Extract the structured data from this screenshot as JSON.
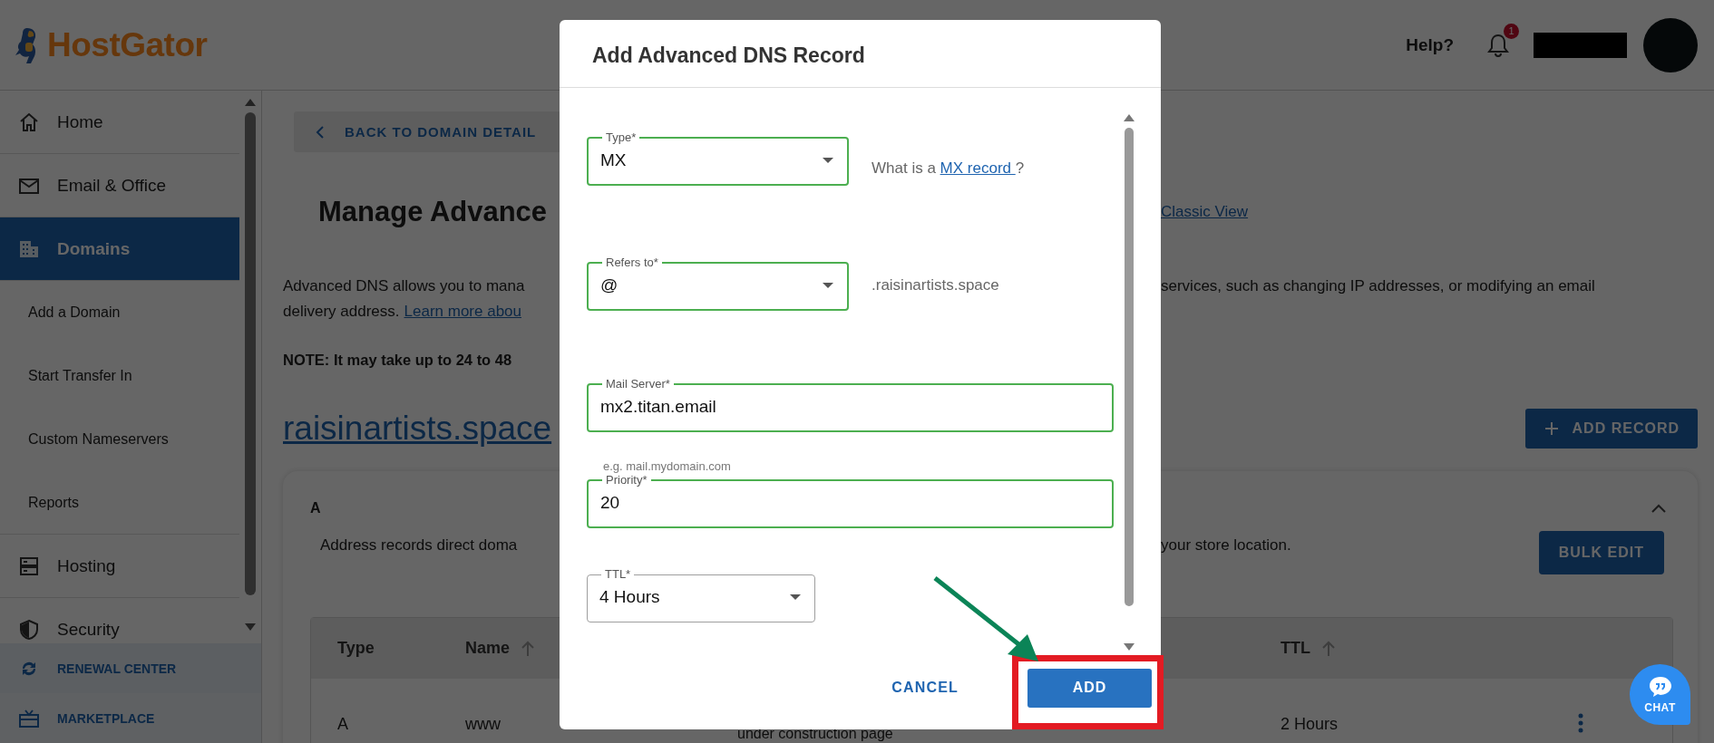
{
  "header": {
    "logo": "HostGator",
    "help": "Help?",
    "notification_count": "1"
  },
  "sidebar": {
    "items": [
      {
        "label": "Home",
        "kind": "section",
        "selected": false
      },
      {
        "label": "Email & Office",
        "kind": "section",
        "selected": false
      },
      {
        "label": "Domains",
        "kind": "section",
        "selected": true
      },
      {
        "label": "Add a Domain",
        "kind": "subitem",
        "selected": false
      },
      {
        "label": "Start Transfer In",
        "kind": "subitem",
        "selected": false
      },
      {
        "label": "Custom Nameservers",
        "kind": "subitem",
        "selected": false
      },
      {
        "label": "Reports",
        "kind": "subitem",
        "selected": false
      },
      {
        "label": "Hosting",
        "kind": "section",
        "selected": false
      },
      {
        "label": "Security",
        "kind": "section",
        "selected": false
      }
    ],
    "footer_links": [
      {
        "label": "RENEWAL CENTER"
      },
      {
        "label": "MARKETPLACE"
      }
    ]
  },
  "page": {
    "back_button": "BACK TO DOMAIN DETAIL",
    "title": "Manage Advance",
    "classic_view": "Classic View",
    "intro_left": "Advanced DNS allows you to mana",
    "intro_right": "services, such as changing IP addresses, or modifying an email",
    "intro_line2": "delivery address.",
    "learn_more": "Learn more abou",
    "note": "NOTE: It may take up to 24 to 48",
    "domain": "raisinartists.space",
    "add_record": "ADD RECORD"
  },
  "record_card": {
    "type": "A",
    "expanded": true,
    "description_left": "Address records direct doma",
    "description_right": "your store location.",
    "bulk_edit": "BULK EDIT",
    "columns": [
      {
        "label": "Type",
        "sortable": false
      },
      {
        "label": "Name",
        "sortable": true
      },
      {
        "label": "TTL",
        "sortable": true
      }
    ],
    "rows": [
      {
        "type": "A",
        "name": "www",
        "column_3": "under construction page",
        "ttl": "2 Hours"
      }
    ]
  },
  "dialog": {
    "title": "Add Advanced DNS Record",
    "fields": [
      {
        "kind": "select",
        "label": "Type*",
        "value": "MX",
        "focused": true,
        "help_prefix": "What is a ",
        "help_link": "MX record ",
        "help_suffix": "?"
      },
      {
        "kind": "select",
        "label": "Refers to*",
        "value": "@",
        "focused": true,
        "suffix": ".raisinartists.space"
      },
      {
        "kind": "text",
        "label": "Mail Server*",
        "value": "mx2.titan.email",
        "focused": true,
        "hint": "e.g. mail.mydomain.com"
      },
      {
        "kind": "text",
        "label": "Priority*",
        "value": "20",
        "focused": true
      },
      {
        "kind": "select",
        "label": "TTL*",
        "value": "4 Hours",
        "focused": false
      }
    ],
    "cancel": "CANCEL",
    "add": "ADD"
  },
  "chat": {
    "label": "CHAT"
  }
}
